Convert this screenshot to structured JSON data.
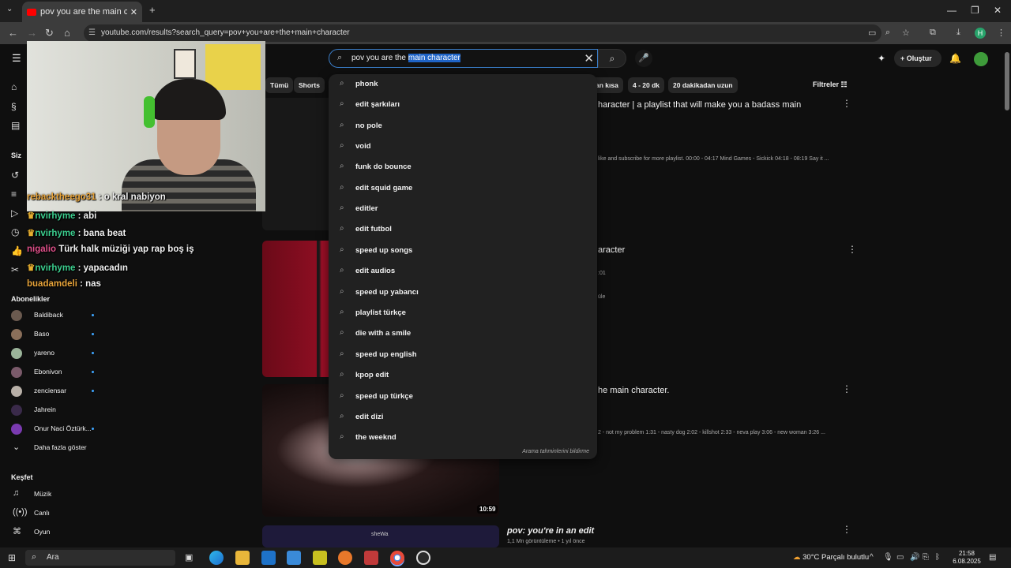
{
  "browser": {
    "tab_title": "pov you are the main characte",
    "url": "youtube.com/results?search_query=pov+you+are+the+main+character"
  },
  "search": {
    "query_plain": "pov you are the ",
    "query_selected": "main character"
  },
  "header": {
    "create_label": "Oluştur"
  },
  "chips": [
    {
      "label": "Tümü"
    },
    {
      "label": "Shorts"
    },
    {
      "label": "an kısa"
    },
    {
      "label": "4 - 20 dk"
    },
    {
      "label": "20 dakikadan uzun"
    }
  ],
  "filters_label": "Filtreler",
  "sidebar": {
    "you_label": "Siz",
    "subs_title": "Abonelikler",
    "subscriptions": [
      {
        "name": "Baldiback",
        "color": "#6b5a4f"
      },
      {
        "name": "Baso",
        "color": "#8a6f5a"
      },
      {
        "name": "yareno",
        "color": "#9bb49a"
      },
      {
        "name": "Ebonivon",
        "color": "#7a5a6a"
      },
      {
        "name": "zenciensar",
        "color": "#b8b0a8"
      },
      {
        "name": "Jahrein",
        "color": "#3a2a4a"
      },
      {
        "name": "Onur Naci Öztürk...",
        "color": "#7a3ab0"
      }
    ],
    "show_more": "Daha fazla göster",
    "explore_title": "Keşfet",
    "explore": [
      {
        "label": "Müzik",
        "icon": "music-icon"
      },
      {
        "label": "Canlı",
        "icon": "live-icon"
      },
      {
        "label": "Oyun",
        "icon": "gaming-icon"
      }
    ]
  },
  "chat": [
    {
      "user": "rebacktheego31",
      "msg": " : o kral nabiyon",
      "color": "#e8a43a"
    },
    {
      "user": "nvirhyme",
      "msg": " : abi",
      "color": "#3ccf8f"
    },
    {
      "user": "nvirhyme",
      "msg": " : bana beat",
      "color": "#3ccf8f"
    },
    {
      "user": "nigalio",
      "msg": " Türk halk müziği yap rap boş iş",
      "color": "#e0508a"
    },
    {
      "user": "nvirhyme",
      "msg": " : yapacadın",
      "color": "#3ccf8f"
    },
    {
      "user": "buadamdeli",
      "msg": " : nas",
      "color": "#e8a43a"
    }
  ],
  "results": {
    "r1_title": "haracter | a playlist that will make you a badass main",
    "r1_desc": "like and subscribe for more playlist. 00:00 - 04:17 Mind Games - Sickick 04:18 - 08:19 Say it ...",
    "r2_title": "aracter",
    "r2_meta1": ":01",
    "r2_meta2": "üle",
    "r3_title": "he main character.",
    "r3_desc": "2 - not my problem 1:31 - nasty dog 2:02 - killshot 2:33 - neva play 3:06 - new woman 3:26 ...",
    "r3_duration": "10:59",
    "r4_title": "pov: you're in an edit",
    "r4_meta": "1,1 Mn görüntüleme • 1 yıl önce",
    "r4_thumb_text": "sheWa"
  },
  "suggestions": [
    "phonk",
    "edit şarkıları",
    "no pole",
    "void",
    "funk do bounce",
    "edit squid game",
    "editler",
    "edit futbol",
    "speed up songs",
    "edit audios",
    "speed up yabancı",
    "playlist türkçe",
    "die with a smile",
    "speed up english",
    "kpop edit",
    "speed up türkçe",
    "edit dizi",
    "the weeknd"
  ],
  "report_label": "Arama tahminlerini bildirme",
  "taskbar": {
    "search_label": "Ara",
    "weather": "30°C  Parçalı bulutlu",
    "time": "21:58",
    "date": "6.08.2025"
  }
}
